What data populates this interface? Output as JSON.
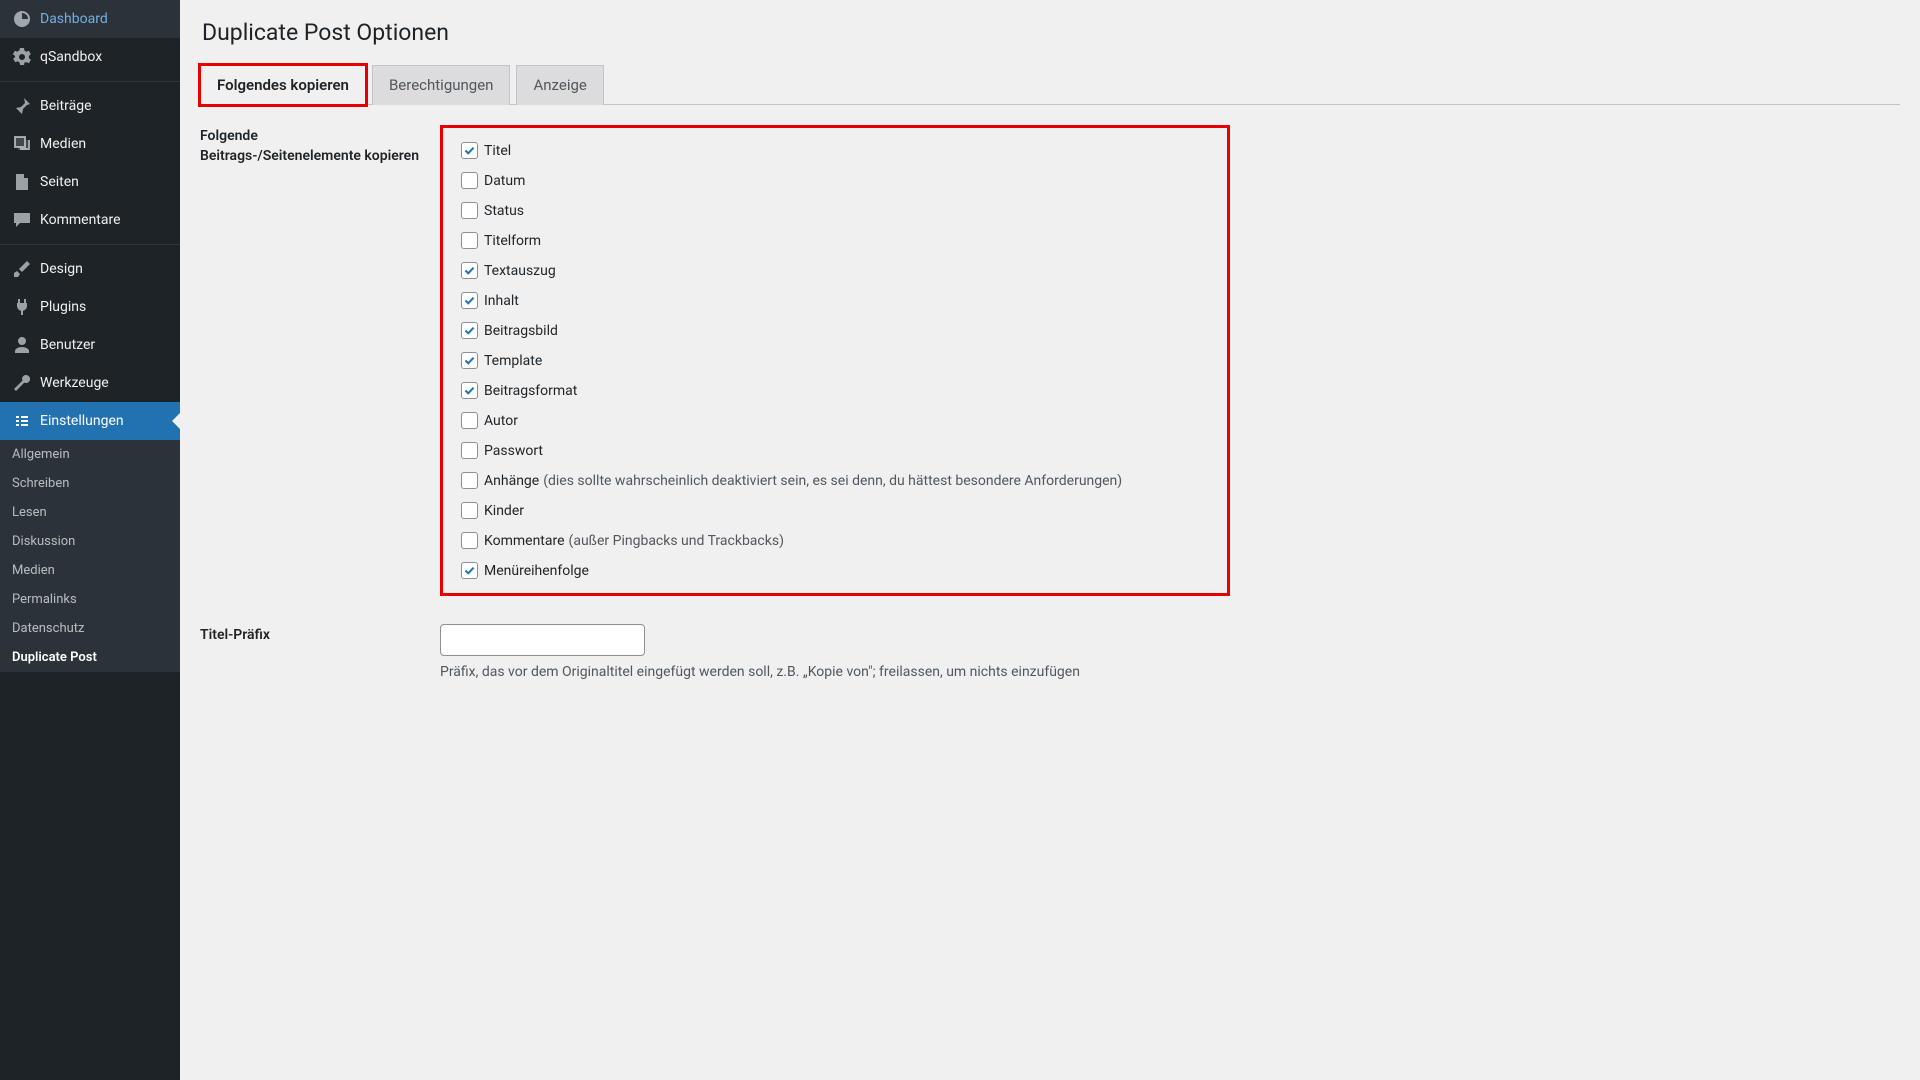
{
  "sidebar": {
    "items": [
      {
        "id": "dashboard",
        "label": "Dashboard",
        "icon": "dashboard-icon"
      },
      {
        "id": "qsandbox",
        "label": "qSandbox",
        "icon": "gear-icon"
      },
      {
        "id": "sep"
      },
      {
        "id": "beitraege",
        "label": "Beiträge",
        "icon": "pin-icon"
      },
      {
        "id": "medien",
        "label": "Medien",
        "icon": "media-icon"
      },
      {
        "id": "seiten",
        "label": "Seiten",
        "icon": "page-icon"
      },
      {
        "id": "kommentare",
        "label": "Kommentare",
        "icon": "comment-icon"
      },
      {
        "id": "sep"
      },
      {
        "id": "design",
        "label": "Design",
        "icon": "brush-icon"
      },
      {
        "id": "plugins",
        "label": "Plugins",
        "icon": "plug-icon"
      },
      {
        "id": "benutzer",
        "label": "Benutzer",
        "icon": "user-icon"
      },
      {
        "id": "werkzeuge",
        "label": "Werkzeuge",
        "icon": "wrench-icon"
      },
      {
        "id": "einstellungen",
        "label": "Einstellungen",
        "icon": "settings-icon",
        "current": true
      }
    ],
    "submenu": [
      {
        "label": "Allgemein"
      },
      {
        "label": "Schreiben"
      },
      {
        "label": "Lesen"
      },
      {
        "label": "Diskussion"
      },
      {
        "label": "Medien"
      },
      {
        "label": "Permalinks"
      },
      {
        "label": "Datenschutz"
      },
      {
        "label": "Duplicate Post",
        "active": true
      }
    ]
  },
  "page": {
    "title": "Duplicate Post Optionen"
  },
  "tabs": [
    {
      "label": "Folgendes kopieren",
      "active": true,
      "highlight": true
    },
    {
      "label": "Berechtigungen"
    },
    {
      "label": "Anzeige"
    }
  ],
  "section": {
    "elements_label": "Folgende Beitrags-/Seitenelemente kopieren",
    "checkboxes": [
      {
        "label": "Titel",
        "checked": true
      },
      {
        "label": "Datum",
        "checked": false
      },
      {
        "label": "Status",
        "checked": false
      },
      {
        "label": "Titelform",
        "checked": false
      },
      {
        "label": "Textauszug",
        "checked": true
      },
      {
        "label": "Inhalt",
        "checked": true
      },
      {
        "label": "Beitragsbild",
        "checked": true
      },
      {
        "label": "Template",
        "checked": true
      },
      {
        "label": "Beitragsformat",
        "checked": true
      },
      {
        "label": "Autor",
        "checked": false
      },
      {
        "label": "Passwort",
        "checked": false
      },
      {
        "label": "Anhänge",
        "checked": false,
        "note": "(dies sollte wahrscheinlich deaktiviert sein, es sei denn, du hättest besondere Anforderungen)"
      },
      {
        "label": "Kinder",
        "checked": false
      },
      {
        "label": "Kommentare",
        "checked": false,
        "note": "(außer Pingbacks und Trackbacks)"
      },
      {
        "label": "Menüreihenfolge",
        "checked": true
      }
    ]
  },
  "prefix": {
    "label": "Titel-Präfix",
    "value": "",
    "help": "Präfix, das vor dem Originaltitel eingefügt werden soll, z.B. „Kopie von\"; freilassen, um nichts einzufügen"
  }
}
